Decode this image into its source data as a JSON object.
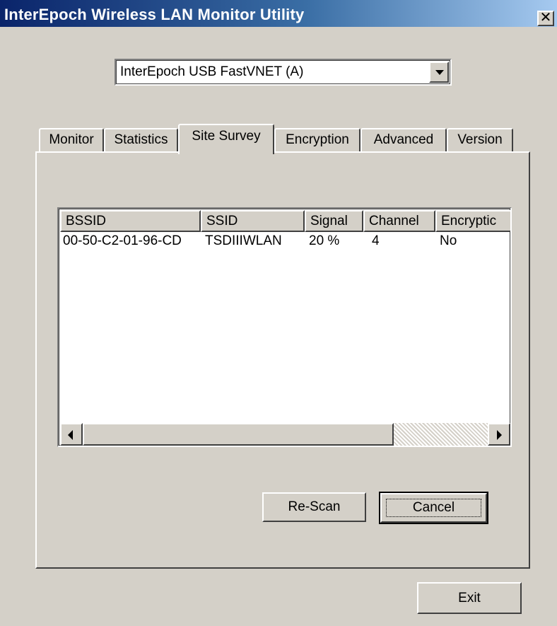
{
  "window": {
    "title": "InterEpoch Wireless LAN Monitor Utility",
    "close_glyph": "✕"
  },
  "adapter": {
    "selected": "InterEpoch USB FastVNET (A)",
    "dropdown_icon": "chevron-down-icon"
  },
  "tabs": [
    {
      "label": "Monitor",
      "active": false
    },
    {
      "label": "Statistics",
      "active": false
    },
    {
      "label": "Site Survey",
      "active": true
    },
    {
      "label": "Encryption",
      "active": false
    },
    {
      "label": "Advanced",
      "active": false
    },
    {
      "label": "Version",
      "active": false
    }
  ],
  "site_survey": {
    "columns": [
      "BSSID",
      "SSID",
      "Signal",
      "Channel",
      "Encryptic"
    ],
    "rows": [
      [
        "00-50-C2-01-96-CD",
        "TSDIIIWLAN",
        "20 %",
        "4",
        "No"
      ]
    ]
  },
  "buttons": {
    "rescan": "Re-Scan",
    "cancel": "Cancel",
    "exit": "Exit"
  },
  "colors": {
    "titlebar_start": "#0a246a",
    "titlebar_end": "#a6caf0",
    "face": "#d4d0c8"
  }
}
